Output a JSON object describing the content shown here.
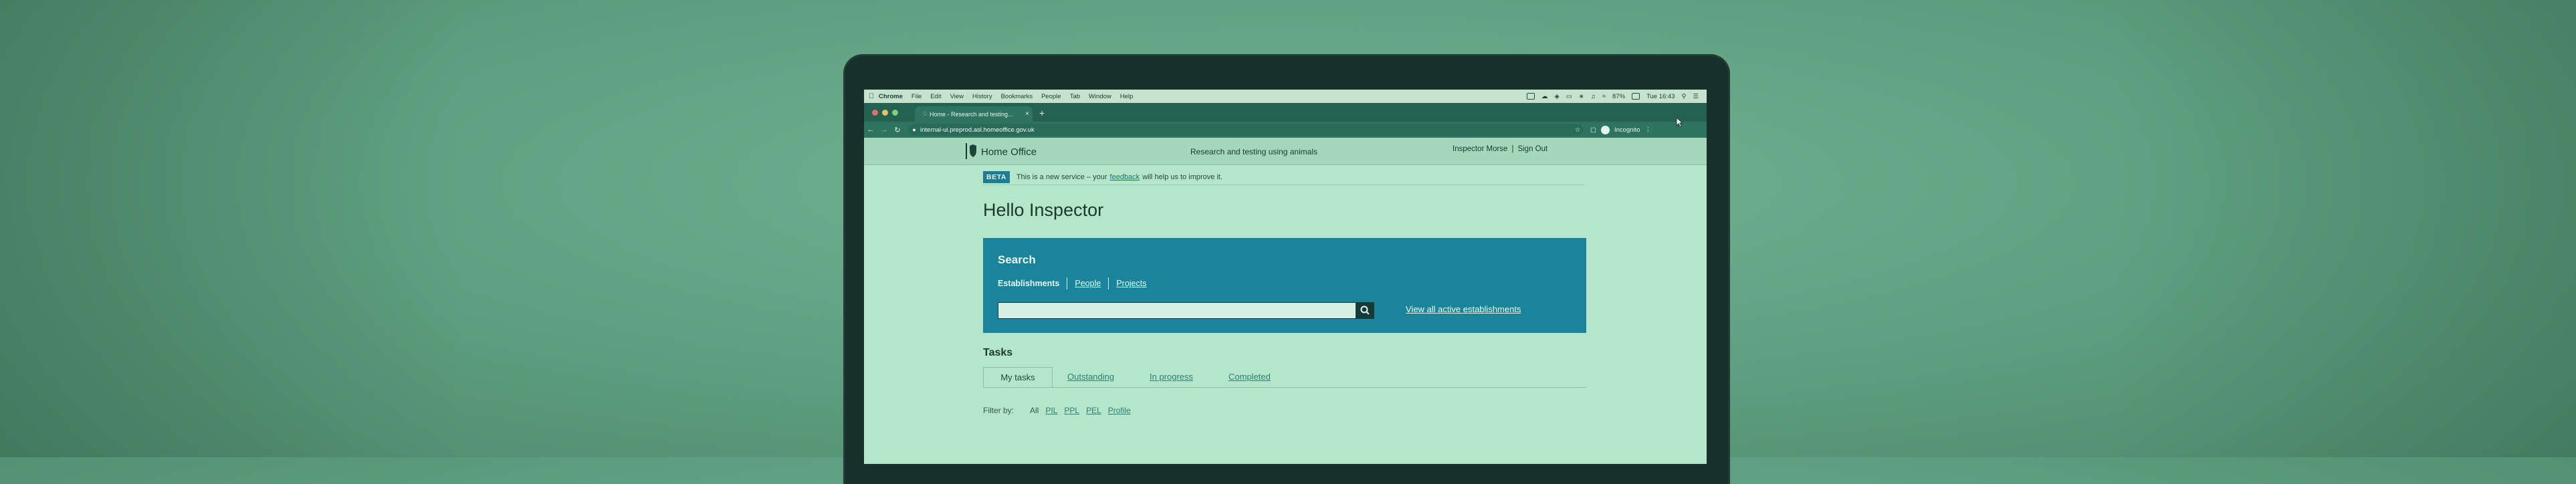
{
  "menubar": {
    "items": [
      "Chrome",
      "File",
      "Edit",
      "View",
      "History",
      "Bookmarks",
      "People",
      "Tab",
      "Window",
      "Help"
    ],
    "battery": "87%",
    "clock": "Tue 16:43"
  },
  "browser": {
    "tab_title": "Home - Research and testing...",
    "url": "internal-ui.preprod.asl.homeoffice.gov.uk",
    "profile_label": "Incognito"
  },
  "header": {
    "brand": "Home Office",
    "service_name": "Research and testing using animals",
    "user_name": "Inspector Morse",
    "separator": "|",
    "sign_out": "Sign Out"
  },
  "beta_banner": {
    "tag": "BETA",
    "text_before": "This is a new service – your",
    "link": "feedback",
    "text_after": "will help us to improve it."
  },
  "page_title": "Hello Inspector",
  "search": {
    "title": "Search",
    "tabs": [
      {
        "label": "Establishments",
        "active": true
      },
      {
        "label": "People",
        "active": false
      },
      {
        "label": "Projects",
        "active": false
      }
    ],
    "input_value": "",
    "view_all": "View all active establishments"
  },
  "tasks": {
    "heading": "Tasks",
    "tabs": [
      "My tasks",
      "Outstanding",
      "In progress",
      "Completed"
    ],
    "active_tab": "My tasks"
  },
  "filter": {
    "label": "Filter by:",
    "options": [
      "All",
      "PIL",
      "PPL",
      "PEL",
      "Profile"
    ]
  },
  "colors": {
    "search_panel": "#1a849b",
    "background": "#67a888",
    "beta_tag": "#1e7c93"
  }
}
